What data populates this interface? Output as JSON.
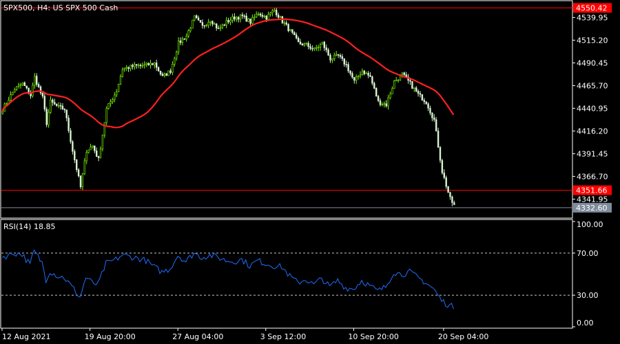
{
  "header": {
    "title": "SPX500, H4:  US SPX 500 Cash"
  },
  "price_panel": {
    "y_ticks": [
      "4539.95",
      "4515.20",
      "4490.45",
      "4465.70",
      "4440.95",
      "4416.20",
      "4391.45",
      "4366.70",
      "4341.95"
    ],
    "levels": [
      {
        "label": "4550.42",
        "value": 4550.42,
        "color": "#ff0000"
      },
      {
        "label": "4351.66",
        "value": 4351.66,
        "color": "#ff0000"
      }
    ],
    "current": {
      "label": "4332.60",
      "value": 4332.6,
      "color": "#7f8c9b"
    }
  },
  "rsi_panel": {
    "label": "RSI(14) 18.85",
    "y_ticks": [
      "100.00",
      "70.00",
      "30.00",
      "0.00"
    ],
    "levels": [
      70,
      30
    ],
    "line_color": "#1e6fff"
  },
  "x_axis": {
    "labels": [
      "12 Aug 2021",
      "19 Aug 20:00",
      "27 Aug 04:00",
      "3 Sep 12:00",
      "10 Sep 20:00",
      "20 Sep 04:00"
    ]
  },
  "colors": {
    "bull": "#7cfc00",
    "bear": "#d8f5d0",
    "ma": "#ff2020",
    "grid": "#ffffff"
  },
  "chart_data": {
    "type": "line",
    "series": [
      {
        "name": "SPX500",
        "close_anchors": [
          [
            0,
            4440
          ],
          [
            6,
            4462
          ],
          [
            10,
            4468
          ],
          [
            14,
            4455
          ],
          [
            16,
            4475
          ],
          [
            20,
            4452
          ],
          [
            22,
            4425
          ],
          [
            24,
            4448
          ],
          [
            28,
            4442
          ],
          [
            31,
            4440
          ],
          [
            35,
            4395
          ],
          [
            39,
            4355
          ],
          [
            42,
            4395
          ],
          [
            45,
            4400
          ],
          [
            48,
            4385
          ],
          [
            52,
            4440
          ],
          [
            57,
            4460
          ],
          [
            60,
            4484
          ],
          [
            66,
            4487
          ],
          [
            72,
            4488
          ],
          [
            76,
            4490
          ],
          [
            80,
            4475
          ],
          [
            84,
            4482
          ],
          [
            88,
            4512
          ],
          [
            92,
            4520
          ],
          [
            96,
            4540
          ],
          [
            100,
            4530
          ],
          [
            104,
            4538
          ],
          [
            108,
            4527
          ],
          [
            112,
            4535
          ],
          [
            116,
            4540
          ],
          [
            120,
            4541
          ],
          [
            124,
            4535
          ],
          [
            128,
            4545
          ],
          [
            132,
            4540
          ],
          [
            136,
            4548
          ],
          [
            140,
            4536
          ],
          [
            144,
            4525
          ],
          [
            148,
            4512
          ],
          [
            152,
            4510
          ],
          [
            156,
            4505
          ],
          [
            160,
            4512
          ],
          [
            164,
            4495
          ],
          [
            168,
            4498
          ],
          [
            172,
            4488
          ],
          [
            176,
            4470
          ],
          [
            180,
            4482
          ],
          [
            184,
            4475
          ],
          [
            188,
            4448
          ],
          [
            192,
            4445
          ],
          [
            196,
            4470
          ],
          [
            200,
            4478
          ],
          [
            204,
            4468
          ],
          [
            208,
            4456
          ],
          [
            212,
            4448
          ],
          [
            216,
            4428
          ],
          [
            220,
            4372
          ],
          [
            224,
            4342
          ],
          [
            226,
            4335
          ]
        ]
      },
      {
        "name": "RSI(14)",
        "anchors": [
          [
            0,
            66
          ],
          [
            6,
            70
          ],
          [
            10,
            69
          ],
          [
            14,
            59
          ],
          [
            16,
            72
          ],
          [
            20,
            61
          ],
          [
            22,
            45
          ],
          [
            24,
            53
          ],
          [
            28,
            48
          ],
          [
            31,
            47
          ],
          [
            35,
            38
          ],
          [
            39,
            28
          ],
          [
            42,
            47
          ],
          [
            45,
            42
          ],
          [
            48,
            40
          ],
          [
            52,
            60
          ],
          [
            57,
            64
          ],
          [
            60,
            68
          ],
          [
            66,
            66
          ],
          [
            72,
            63
          ],
          [
            76,
            57
          ],
          [
            80,
            52
          ],
          [
            84,
            55
          ],
          [
            88,
            68
          ],
          [
            92,
            62
          ],
          [
            96,
            70
          ],
          [
            100,
            66
          ],
          [
            104,
            68
          ],
          [
            108,
            66
          ],
          [
            112,
            63
          ],
          [
            116,
            62
          ],
          [
            120,
            64
          ],
          [
            124,
            58
          ],
          [
            128,
            63
          ],
          [
            132,
            60
          ],
          [
            136,
            58
          ],
          [
            140,
            57
          ],
          [
            144,
            48
          ],
          [
            148,
            42
          ],
          [
            152,
            45
          ],
          [
            156,
            40
          ],
          [
            160,
            46
          ],
          [
            164,
            38
          ],
          [
            168,
            44
          ],
          [
            172,
            37
          ],
          [
            176,
            36
          ],
          [
            180,
            44
          ],
          [
            184,
            39
          ],
          [
            188,
            34
          ],
          [
            192,
            38
          ],
          [
            196,
            52
          ],
          [
            200,
            50
          ],
          [
            204,
            52
          ],
          [
            208,
            47
          ],
          [
            212,
            42
          ],
          [
            216,
            36
          ],
          [
            220,
            25
          ],
          [
            224,
            20
          ],
          [
            226,
            18.85
          ]
        ]
      }
    ],
    "y_range_price": [
      4325,
      4556
    ],
    "y_range_rsi": [
      0,
      100
    ],
    "candles": 227,
    "ma_period": 40
  }
}
